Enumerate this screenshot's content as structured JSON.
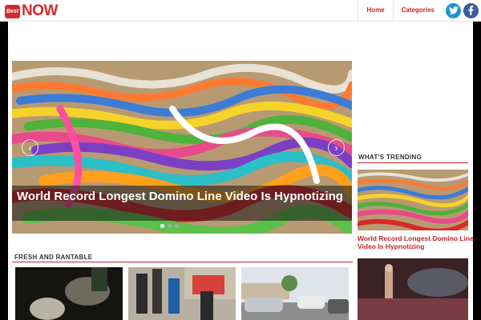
{
  "header": {
    "logo_badge": "Best",
    "logo_text": "NOW",
    "nav": [
      {
        "label": "Home"
      },
      {
        "label": "Categories"
      }
    ],
    "social": [
      "twitter-icon",
      "facebook-icon"
    ]
  },
  "slider": {
    "caption": "World Record Longest Domino Line Video Is Hypnotizing",
    "prev_icon": "chevron-left-icon",
    "next_icon": "chevron-right-icon",
    "slide_count": 3,
    "active_slide": 1
  },
  "trending": {
    "title": "WHAT'S TRENDING",
    "items": [
      {
        "caption": "World Record Longest Domino Line Video Is Hypnotizing"
      }
    ]
  },
  "fresh": {
    "title": "FRESH AND RANTABLE"
  },
  "colors": {
    "brand_red": "#c8222b",
    "twitter": "#1c93d6",
    "facebook": "#3b5b9a"
  }
}
